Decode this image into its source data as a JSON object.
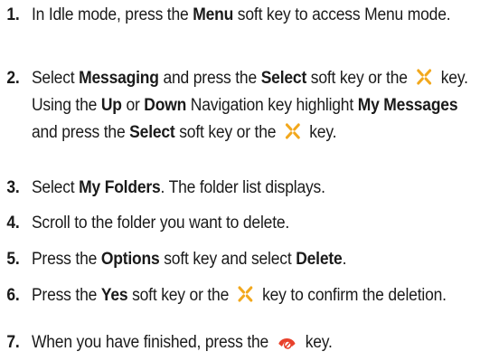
{
  "steps": [
    {
      "num": "1.",
      "parts": [
        "In Idle mode, press the ",
        "Menu",
        " soft key to access Menu mode."
      ]
    },
    {
      "num": "2.",
      "parts": [
        "Select ",
        "Messaging",
        " and press the ",
        "Select",
        " soft key or the ",
        " key. Using the ",
        "Up",
        " or ",
        "Down",
        " Navigation key highlight ",
        "My Messages",
        " and press the ",
        "Select",
        " soft key or the ",
        " key."
      ]
    },
    {
      "num": "3.",
      "parts": [
        "Select ",
        "My Folders",
        ". The folder list displays."
      ]
    },
    {
      "num": "4.",
      "parts": [
        "Scroll to the folder you want to delete."
      ]
    },
    {
      "num": "5.",
      "parts": [
        "Press the ",
        "Options",
        " soft key and select ",
        "Delete",
        "."
      ]
    },
    {
      "num": "6.",
      "parts": [
        "Press the ",
        "Yes",
        " soft key or the ",
        " key to confirm the deletion."
      ]
    },
    {
      "num": "7.",
      "parts": [
        "When you have finished, press the ",
        " key."
      ]
    }
  ],
  "icons": {
    "ok_key": "ok-key-icon",
    "end_key": "end-key-icon",
    "ok_key_color": "#f2a81d",
    "end_key_color": "#e8412b"
  }
}
